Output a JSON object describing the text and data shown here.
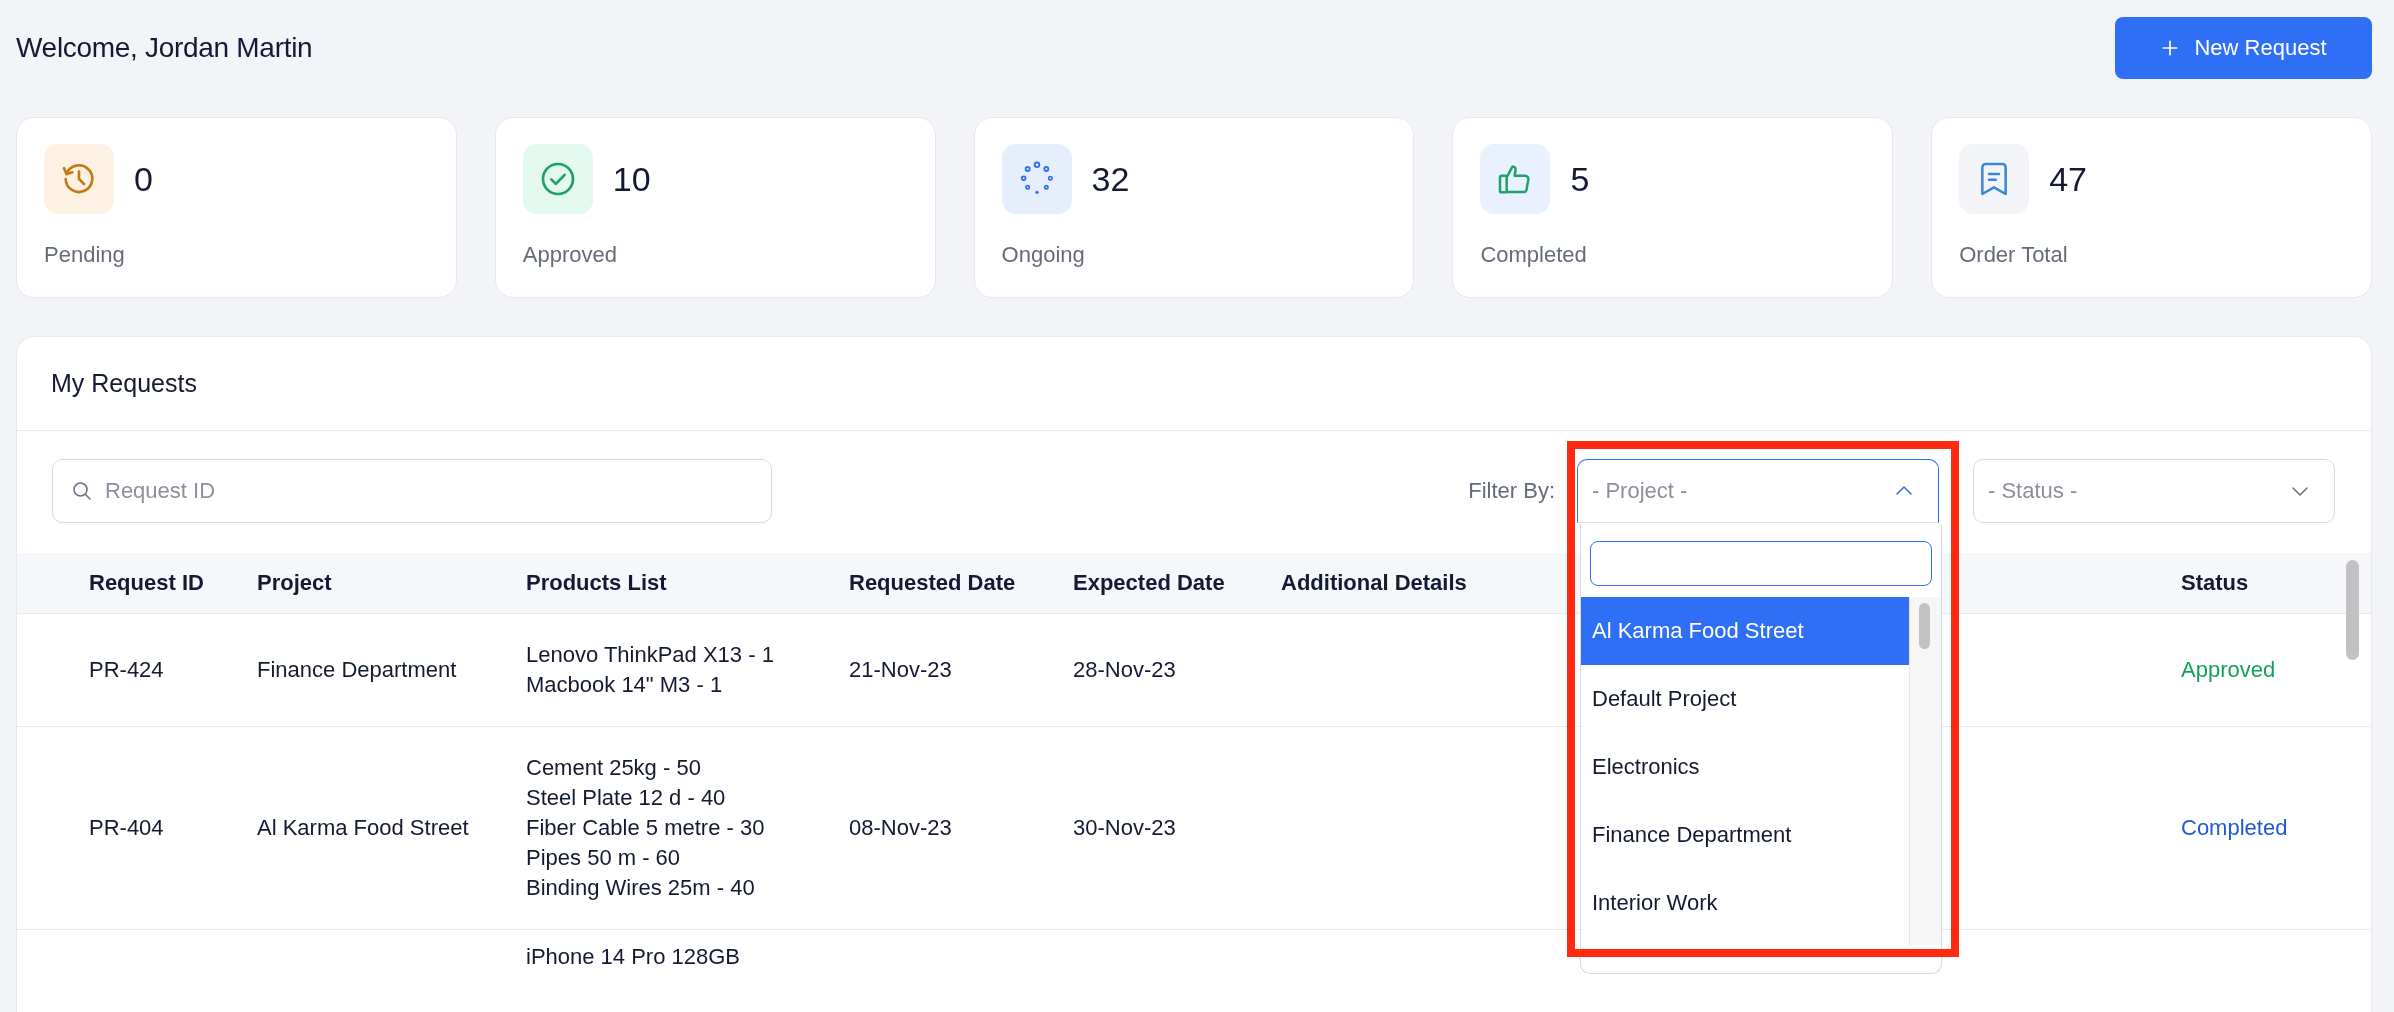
{
  "header": {
    "title": "Welcome, Jordan Martin",
    "button_label": "New Request"
  },
  "stats": [
    {
      "kind": "pending",
      "value": "0",
      "label": "Pending"
    },
    {
      "kind": "approved",
      "value": "10",
      "label": "Approved"
    },
    {
      "kind": "ongoing",
      "value": "32",
      "label": "Ongoing"
    },
    {
      "kind": "completed",
      "value": "5",
      "label": "Completed"
    },
    {
      "kind": "total",
      "value": "47",
      "label": "Order Total"
    }
  ],
  "requests": {
    "title": "My Requests",
    "search": {
      "placeholder": "Request ID"
    },
    "filter_label": "Filter By:",
    "filters": [
      {
        "placeholder": "- Project -",
        "expanded": true,
        "options": [
          {
            "label": "Al Karma Food Street",
            "selected": true
          },
          {
            "label": "Default Project",
            "selected": false
          },
          {
            "label": "Electronics",
            "selected": false
          },
          {
            "label": "Finance Department",
            "selected": false
          },
          {
            "label": "Interior Work",
            "selected": false
          }
        ]
      },
      {
        "placeholder": "- Status -",
        "expanded": false
      }
    ],
    "table": {
      "columns": [
        "Request ID",
        "Project",
        "Products List",
        "Requested Date",
        "Expected Date",
        "Additional Details",
        "Status"
      ],
      "rows": [
        {
          "request_id": "PR-424",
          "project": "Finance Department",
          "products": [
            "Lenovo ThinkPad X13 - 1",
            "Macbook 14\" M3 - 1"
          ],
          "requested_date": "21-Nov-23",
          "expected_date": "28-Nov-23",
          "status": "Approved",
          "color": "#14a05a"
        },
        {
          "request_id": "PR-404",
          "project": "Al Karma Food Street",
          "products": [
            "Cement 25kg - 50",
            "Steel Plate 12 d - 40",
            "Fiber Cable 5 metre - 30",
            "Pipes 50 m - 60",
            "Binding Wires 25m - 40"
          ],
          "requested_date": "08-Nov-23",
          "expected_date": "30-Nov-23",
          "status": "Completed",
          "color": "#1f5bd6"
        },
        {
          "products": [
            "iPhone 14 Pro 128GB"
          ]
        }
      ]
    }
  }
}
